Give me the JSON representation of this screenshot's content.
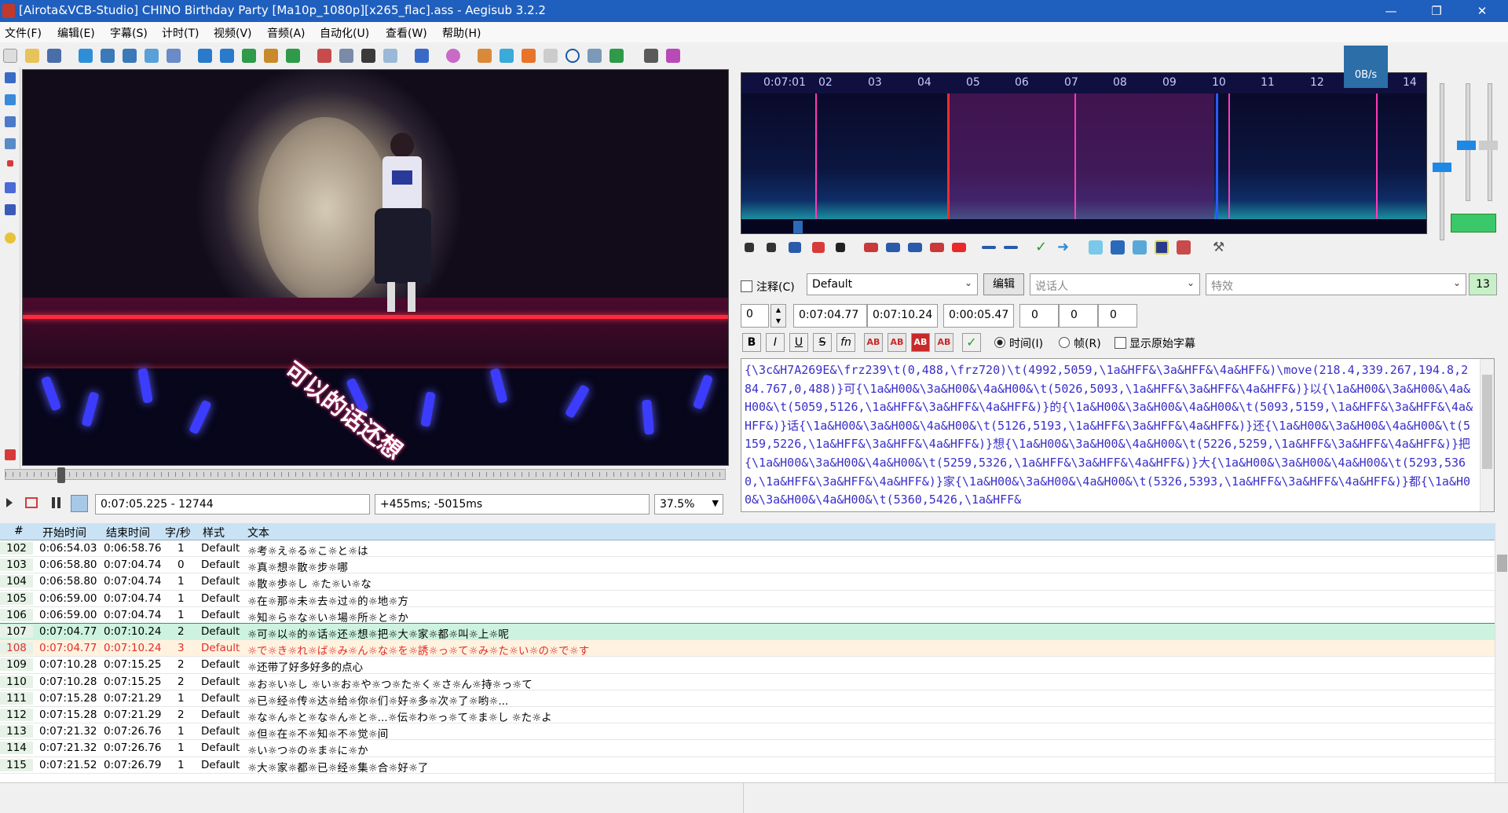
{
  "window": {
    "title": "[Airota&VCB-Studio] CHINO Birthday Party [Ma10p_1080p][x265_flac].ass - Aegisub 3.2.2",
    "minimize": "—",
    "restore": "❐",
    "close": "✕"
  },
  "menu": [
    "文件(F)",
    "编辑(E)",
    "字幕(S)",
    "计时(T)",
    "视频(V)",
    "音频(A)",
    "自动化(U)",
    "查看(W)",
    "帮助(H)"
  ],
  "video": {
    "overlay_text": "可以的话还想",
    "time_field": "0:07:05.225 - 12744",
    "offset_field": "+455ms; -5015ms",
    "zoom": "37.5%"
  },
  "audio": {
    "ruler_start": "0:07:01",
    "ruler_ticks": [
      "02",
      "03",
      "04",
      "05",
      "06",
      "07",
      "08",
      "09",
      "10",
      "11",
      "12",
      "13",
      "14"
    ],
    "speed_badge": "0B/s"
  },
  "edit": {
    "comment_label": "注释(C)",
    "style": "Default",
    "edit_button": "编辑",
    "actor_placeholder": "说话人",
    "effect_placeholder": "特效",
    "char_count": "13",
    "layer": "0",
    "start_time": "0:07:04.77",
    "end_time": "0:07:10.24",
    "duration": "0:00:05.47",
    "margin_l": "0",
    "margin_r": "0",
    "margin_v": "0",
    "bold": "B",
    "italic": "I",
    "underline": "U",
    "strike": "S",
    "font": "fn",
    "time_radio": "时间(I)",
    "frame_radio": "帧(R)",
    "show_original": "显示原始字幕",
    "text": "{\\3c&H7A269E&\\frz239\\t(0,488,\\frz720)\\t(4992,5059,\\1a&HFF&\\3a&HFF&\\4a&HFF&)\\move(218.4,339.267,194.8,284.767,0,488)}可{\\1a&H00&\\3a&H00&\\4a&H00&\\t(5026,5093,\\1a&HFF&\\3a&HFF&\\4a&HFF&)}以{\\1a&H00&\\3a&H00&\\4a&H00&\\t(5059,5126,\\1a&HFF&\\3a&HFF&\\4a&HFF&)}的{\\1a&H00&\\3a&H00&\\4a&H00&\\t(5093,5159,\\1a&HFF&\\3a&HFF&\\4a&HFF&)}话{\\1a&H00&\\3a&H00&\\4a&H00&\\t(5126,5193,\\1a&HFF&\\3a&HFF&\\4a&HFF&)}还{\\1a&H00&\\3a&H00&\\4a&H00&\\t(5159,5226,\\1a&HFF&\\3a&HFF&\\4a&HFF&)}想{\\1a&H00&\\3a&H00&\\4a&H00&\\t(5226,5259,\\1a&HFF&\\3a&HFF&\\4a&HFF&)}把{\\1a&H00&\\3a&H00&\\4a&H00&\\t(5259,5326,\\1a&HFF&\\3a&HFF&\\4a&HFF&)}大{\\1a&H00&\\3a&H00&\\4a&H00&\\t(5293,5360,\\1a&HFF&\\3a&HFF&\\4a&HFF&)}家{\\1a&H00&\\3a&H00&\\4a&H00&\\t(5326,5393,\\1a&HFF&\\3a&HFF&\\4a&HFF&)}都{\\1a&H00&\\3a&H00&\\4a&H00&\\t(5360,5426,\\1a&HFF&"
  },
  "grid": {
    "headers": [
      "#",
      "开始时间",
      "结束时间",
      "字/秒",
      "样式",
      "文本"
    ],
    "rows": [
      {
        "n": "102",
        "start": "0:06:54.03",
        "end": "0:06:58.76",
        "cps": "1",
        "style": "Default",
        "text": "☼考☼え☼る☼こ☼と☼は"
      },
      {
        "n": "103",
        "start": "0:06:58.80",
        "end": "0:07:04.74",
        "cps": "0",
        "style": "Default",
        "text": "☼真☼想☼散☼步☼哪"
      },
      {
        "n": "104",
        "start": "0:06:58.80",
        "end": "0:07:04.74",
        "cps": "1",
        "style": "Default",
        "text": "☼散☼歩☼し ☼た☼い☼な"
      },
      {
        "n": "105",
        "start": "0:06:59.00",
        "end": "0:07:04.74",
        "cps": "1",
        "style": "Default",
        "text": "☼在☼那☼未☼去☼过☼的☼地☼方"
      },
      {
        "n": "106",
        "start": "0:06:59.00",
        "end": "0:07:04.74",
        "cps": "1",
        "style": "Default",
        "text": "☼知☼ら☼な☼い☼場☼所☼と☼か"
      },
      {
        "n": "107",
        "start": "0:07:04.77",
        "end": "0:07:10.24",
        "cps": "2",
        "style": "Default",
        "text": "☼可☼以☼的☼话☼还☼想☼把☼大☼家☼都☼叫☼上☼呢"
      },
      {
        "n": "108",
        "start": "0:07:04.77",
        "end": "0:07:10.24",
        "cps": "3",
        "style": "Default",
        "text": "☼で☼き☼れ☼ば☼み☼ん☼な☼を☼誘☼っ☼て☼み☼た☼い☼の☼で☼す"
      },
      {
        "n": "109",
        "start": "0:07:10.28",
        "end": "0:07:15.25",
        "cps": "2",
        "style": "Default",
        "text": "☼还带了好多好多的点心"
      },
      {
        "n": "110",
        "start": "0:07:10.28",
        "end": "0:07:15.25",
        "cps": "2",
        "style": "Default",
        "text": "☼お☼い☼し ☼い☼お☼や☼つ☼た☼く☼さ☼ん☼持☼っ☼て"
      },
      {
        "n": "111",
        "start": "0:07:15.28",
        "end": "0:07:21.29",
        "cps": "1",
        "style": "Default",
        "text": "☼已☼经☼传☼达☼给☼你☼们☼好☼多☼次☼了☼哟☼..."
      },
      {
        "n": "112",
        "start": "0:07:15.28",
        "end": "0:07:21.29",
        "cps": "2",
        "style": "Default",
        "text": "☼な☼ん☼と☼な☼ん☼と☼...☼伝☼わ☼っ☼て☼ま☼し ☼た☼よ"
      },
      {
        "n": "113",
        "start": "0:07:21.32",
        "end": "0:07:26.76",
        "cps": "1",
        "style": "Default",
        "text": "☼但☼在☼不☼知☼不☼觉☼间"
      },
      {
        "n": "114",
        "start": "0:07:21.32",
        "end": "0:07:26.76",
        "cps": "1",
        "style": "Default",
        "text": "☼い☼つ☼の☼ま☼に☼か"
      },
      {
        "n": "115",
        "start": "0:07:21.52",
        "end": "0:07:26.79",
        "cps": "1",
        "style": "Default",
        "text": "☼大☼家☼都☼已☼经☼集☼合☼好☼了"
      }
    ]
  },
  "colors": {
    "titlebar": "#1f5fbe",
    "selected_row": "#cdf3e0",
    "active_row_text": "#e0302a",
    "active_row_bg": "#fff3e0",
    "spectrum_select": "#6e1e6e",
    "marker": "#ff3ab8"
  }
}
